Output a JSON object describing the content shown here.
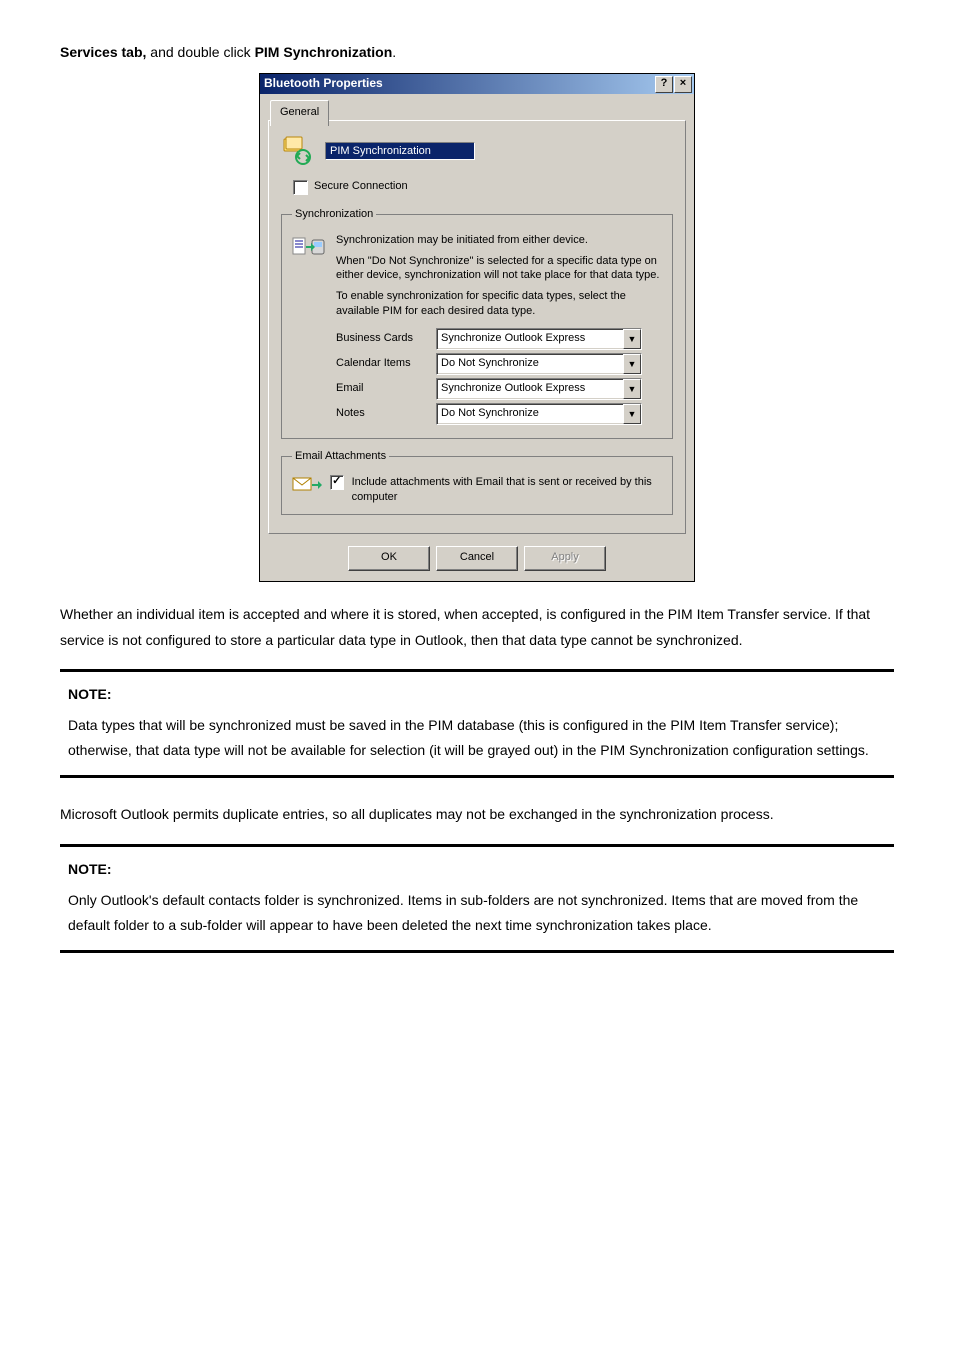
{
  "doc": {
    "intro_prefix": "Services tab,",
    "intro_mid": " and double click ",
    "intro_bold2": "PIM Synchronization",
    "intro_suffix": ".",
    "para1": "Whether an individual item is accepted and where it is stored, when accepted, is configured in the PIM Item Transfer service. If that service is not configured to store a particular data type in Outlook, then that data type cannot be synchronized.",
    "note1_hd": "NOTE:",
    "note1_body": "Data types that will be synchronized must be saved in the PIM database (this is configured in the PIM Item Transfer service); otherwise, that data type will not be available for selection (it will be grayed out) in the PIM Synchronization configuration settings.",
    "para2": "Microsoft Outlook permits duplicate entries, so all duplicates may not be exchanged in the synchronization process.",
    "note2_hd": "NOTE:",
    "note2_body": "Only Outlook's default contacts folder is synchronized. Items in sub-folders are not synchronized. Items that are moved from the default folder to a sub-folder will appear to have been deleted the next time synchronization takes place."
  },
  "dialog": {
    "title": "Bluetooth Properties",
    "help_glyph": "?",
    "close_glyph": "×",
    "tab_label": "General",
    "name_value": "PIM Synchronization",
    "secure_label": "Secure Connection",
    "sync_group": "Synchronization",
    "sync_line1": "Synchronization may be initiated from either device.",
    "sync_line2": "When \"Do Not Synchronize\" is selected for a specific data type on either device, synchronization will not take place for that data type.",
    "sync_line3": "To enable synchronization for specific data types, select the available PIM for each desired data type.",
    "rows": [
      {
        "label": "Business Cards",
        "value": "Synchronize Outlook Express"
      },
      {
        "label": "Calendar Items",
        "value": "Do Not Synchronize"
      },
      {
        "label": "Email",
        "value": "Synchronize Outlook Express"
      },
      {
        "label": "Notes",
        "value": "Do Not Synchronize"
      }
    ],
    "email_group": "Email Attachments",
    "email_chk_label": "Include attachments with Email that is sent or received by this computer",
    "btn_ok": "OK",
    "btn_cancel": "Cancel",
    "btn_apply": "Apply"
  }
}
